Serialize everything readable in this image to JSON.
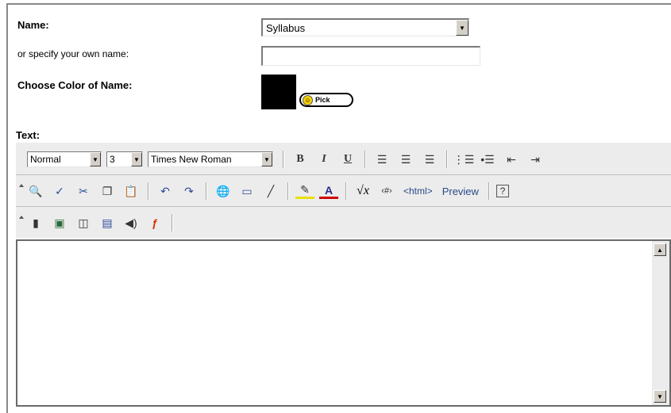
{
  "form": {
    "name_label": "Name:",
    "name_value": "Syllabus",
    "own_name_label": "or specify your own name:",
    "own_name_value": "",
    "color_label": "Choose Color of Name:",
    "color_value": "#000000",
    "pick_label": "Pick",
    "text_label": "Text:"
  },
  "toolbar": {
    "row1": {
      "format_value": "Normal",
      "size_value": "3",
      "font_value": "Times New Roman",
      "bold": "B",
      "italic": "I",
      "underline": "U"
    },
    "row2": {
      "html_label": "<html>",
      "preview_label": "Preview"
    }
  },
  "editor": {
    "content": ""
  }
}
